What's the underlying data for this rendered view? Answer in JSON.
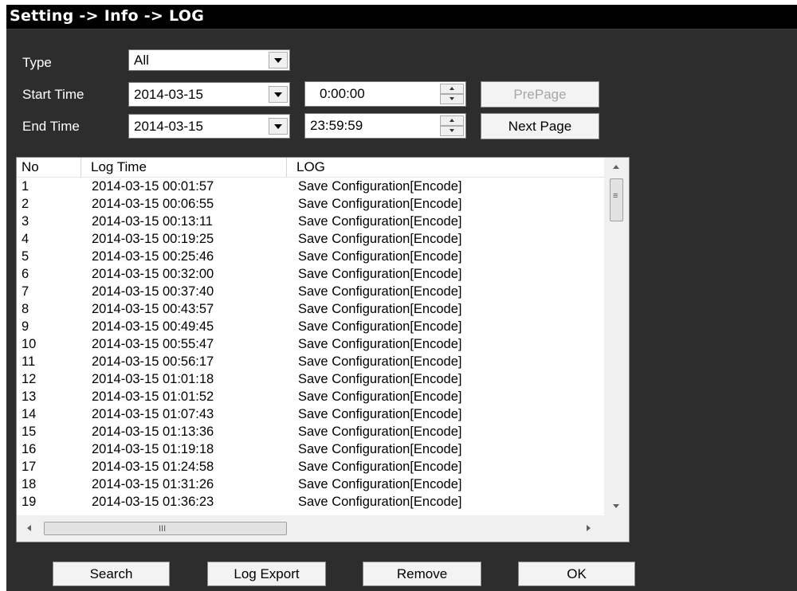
{
  "title": "Setting -> Info -> LOG",
  "filters": {
    "type_label": "Type",
    "type_value": "All",
    "start_label": "Start Time",
    "start_date": "2014-03-15",
    "start_time": "0:00:00",
    "end_label": "End Time",
    "end_date": "2014-03-15",
    "end_time": "23:59:59"
  },
  "paging": {
    "prev_label": "PrePage",
    "next_label": "Next Page"
  },
  "table": {
    "columns": [
      "No",
      "Log Time",
      "LOG"
    ],
    "rows": [
      [
        "1",
        "2014-03-15 00:01:57",
        "Save Configuration[Encode]"
      ],
      [
        "2",
        "2014-03-15 00:06:55",
        "Save Configuration[Encode]"
      ],
      [
        "3",
        "2014-03-15 00:13:11",
        "Save Configuration[Encode]"
      ],
      [
        "4",
        "2014-03-15 00:19:25",
        "Save Configuration[Encode]"
      ],
      [
        "5",
        "2014-03-15 00:25:46",
        "Save Configuration[Encode]"
      ],
      [
        "6",
        "2014-03-15 00:32:00",
        "Save Configuration[Encode]"
      ],
      [
        "7",
        "2014-03-15 00:37:40",
        "Save Configuration[Encode]"
      ],
      [
        "8",
        "2014-03-15 00:43:57",
        "Save Configuration[Encode]"
      ],
      [
        "9",
        "2014-03-15 00:49:45",
        "Save Configuration[Encode]"
      ],
      [
        "10",
        "2014-03-15 00:55:47",
        "Save Configuration[Encode]"
      ],
      [
        "11",
        "2014-03-15 00:56:17",
        "Save Configuration[Encode]"
      ],
      [
        "12",
        "2014-03-15 01:01:18",
        "Save Configuration[Encode]"
      ],
      [
        "13",
        "2014-03-15 01:01:52",
        "Save Configuration[Encode]"
      ],
      [
        "14",
        "2014-03-15 01:07:43",
        "Save Configuration[Encode]"
      ],
      [
        "15",
        "2014-03-15 01:13:36",
        "Save Configuration[Encode]"
      ],
      [
        "16",
        "2014-03-15 01:19:18",
        "Save Configuration[Encode]"
      ],
      [
        "17",
        "2014-03-15 01:24:58",
        "Save Configuration[Encode]"
      ],
      [
        "18",
        "2014-03-15 01:31:26",
        "Save Configuration[Encode]"
      ],
      [
        "19",
        "2014-03-15 01:36:23",
        "Save Configuration[Encode]"
      ]
    ]
  },
  "hscroll_grip": "III",
  "actions": {
    "search": "Search",
    "export": "Log Export",
    "remove": "Remove",
    "ok": "OK"
  }
}
